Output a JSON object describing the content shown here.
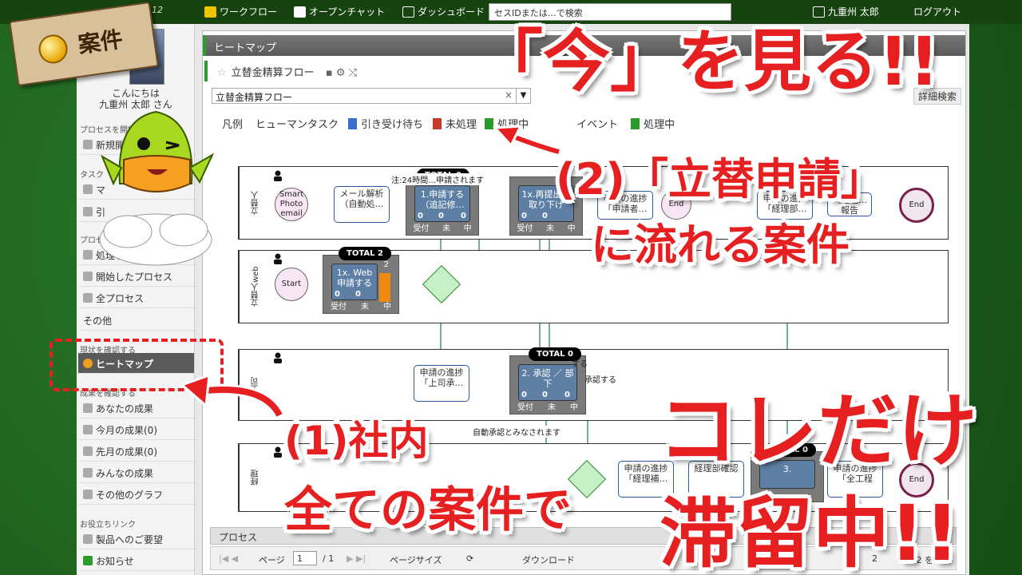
{
  "topbar": {
    "logo": "12",
    "workflow": "ワークフロー",
    "openchat": "オープンチャット",
    "dashboard": "ダッシュボード",
    "search_placeholder": "セスIDまたは…で検索",
    "user": "九重州 太郎",
    "logout": "ログアウト"
  },
  "sidebar": {
    "greeting": "こんにちは",
    "username": "九重州 太郎 さん",
    "section_process": "プロセスを開始",
    "new_label": "新規開",
    "section_task": "タスク",
    "task_item_1": "マ",
    "task_item_2": "引",
    "section_process2": "プロセス",
    "processed_task": "処理したタスク",
    "started_process": "開始したプロセス",
    "all_process": "全プロセス",
    "other": "その他",
    "section_status": "現状を確認する",
    "heatmap": "ヒートマップ",
    "section_result": "成果を確認する",
    "your_result": "あなたの成果",
    "this_month": "今月の成果(0)",
    "last_month": "先月の成果(0)",
    "everyone": "みんなの成果",
    "other_graph": "その他のグラフ",
    "section_links": "お役立ちリンク",
    "request": "製品へのご要望",
    "news": "お知らせ"
  },
  "main": {
    "heatmap_title": "ヒートマップ",
    "flow_title": "立替金精算フロー",
    "flow_select": "立替金精算フロー",
    "detail_search": "詳細検索",
    "legend": {
      "label": "凡例",
      "human_task": "ヒューマンタスク",
      "waiting": "引き受け待ち",
      "unprocessed": "未処理",
      "processing": "処理中",
      "event": "イベント",
      "event_processing": "処理中",
      "waiting_color": "#3b6fcf",
      "unprocessed_color": "#c83a28",
      "processing_color": "#2a9a2a"
    }
  },
  "diagram": {
    "lane1": "立替人",
    "lane2": "立替人web",
    "lane3": "上司",
    "lane4": "経理",
    "start_smart": "Smart Photo email",
    "start": "Start",
    "end": "End",
    "mail_parse": "メール解析（自動処…",
    "task1": "1.申請する（追記修…",
    "task1x_redo": "1x.再提出・取り下げ",
    "task_progress1": "申請の進捗「申請者…",
    "task_progress_keiri": "申請の進捗「経理部…",
    "task_keiri_memo": "（経理…報告",
    "task1x_web": "1x. Web 申請する",
    "task_progress_boss": "申請の進捗「上司承…",
    "task2": "2. 承認 ／ 部下",
    "task_progress_keiri2": "申請の進捗「経理補…",
    "task_keiri_check": "経理部確認",
    "task3": "3.",
    "task_progress_complete": "申請の進捗「全工程",
    "total0": "TOTAL 0",
    "total2": "TOTAL 2",
    "note1": "注:24時間…申請されます",
    "note2": "自動承認とみなされます",
    "note3": "承認する",
    "note4": "する",
    "count_zero": "0",
    "count_two": "2",
    "col_accept": "受付",
    "col_not": "未",
    "col_mid": "中"
  },
  "bottom": {
    "process": "プロセス",
    "page": "ページ",
    "page_num": "1",
    "page_total": "/ 1",
    "page_size": "ページサイズ",
    "download": "ダウンロード",
    "count": "2",
    "range": "- 2 を表示"
  },
  "overlay": {
    "sign": "案件",
    "headline": "「今」を見る!!",
    "point2_line1": "(2)「立替申請」",
    "point2_line2": "に流れる案件",
    "point1_line1": "(1)社内",
    "point1_line2": "全ての案件で",
    "right_line1": "コレだけ",
    "right_line2": "滞留中!!"
  }
}
